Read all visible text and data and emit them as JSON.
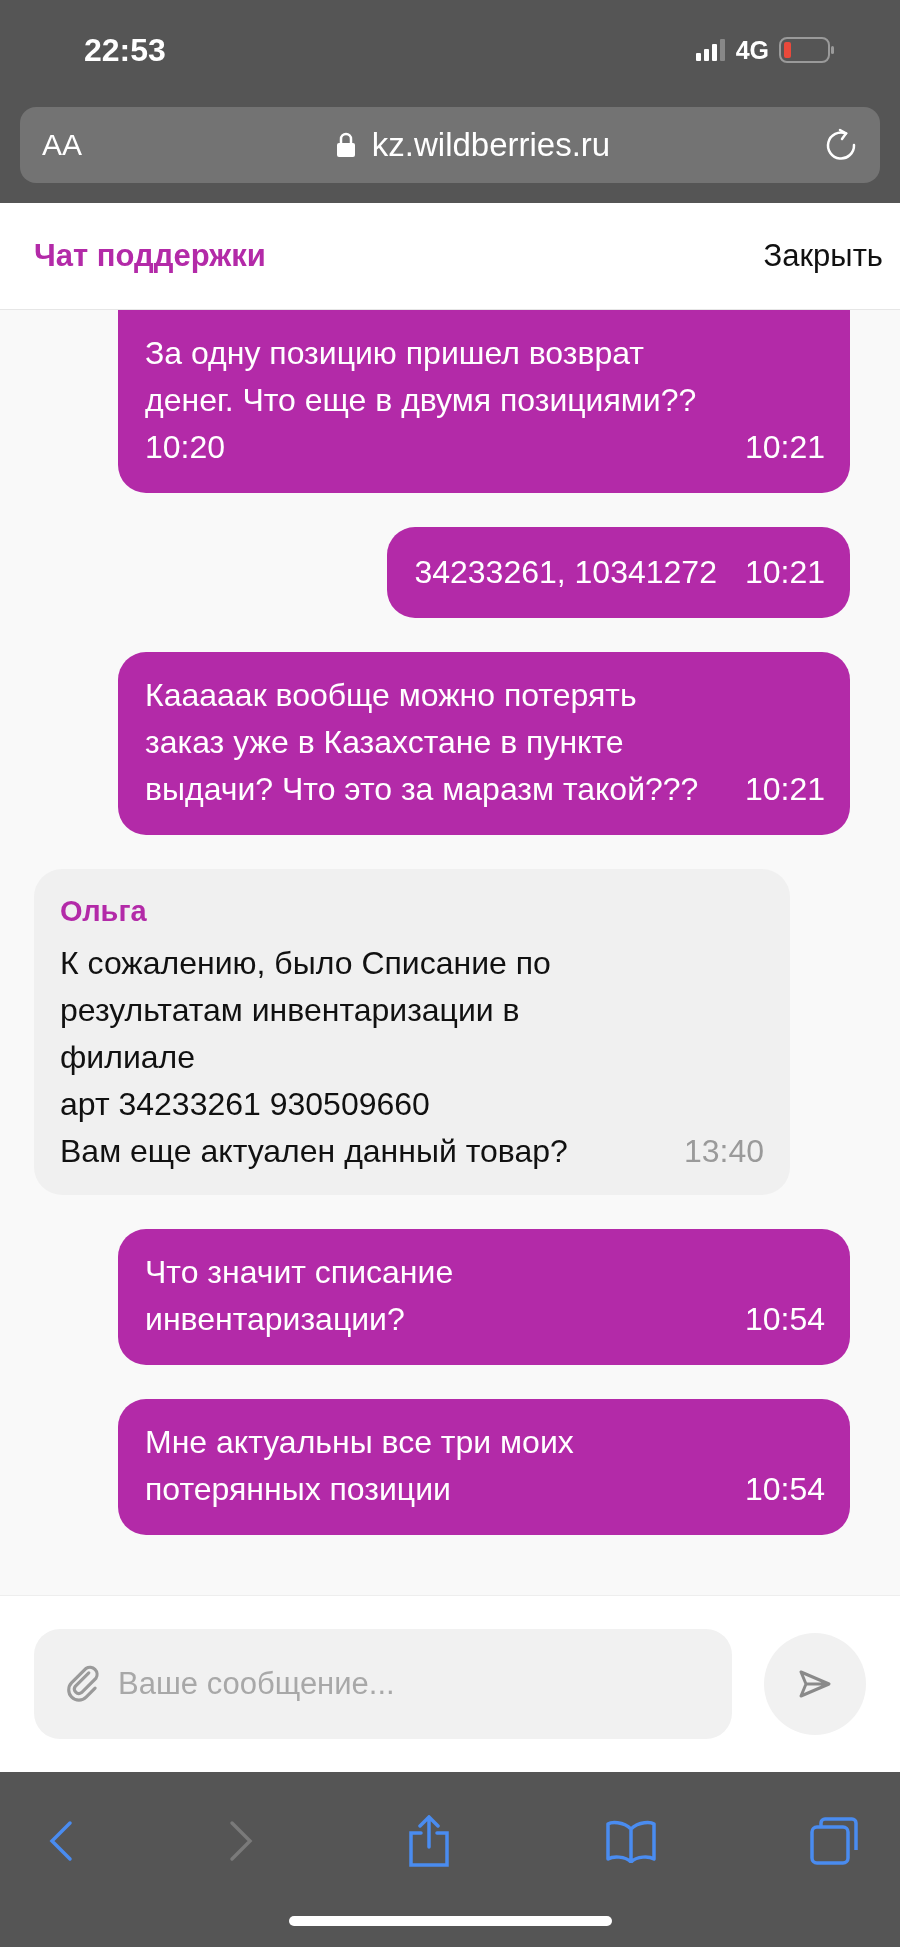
{
  "status_bar": {
    "time": "22:53",
    "network": "4G"
  },
  "browser": {
    "text_size": "AA",
    "url": "kz.wildberries.ru"
  },
  "header": {
    "title": "Чат поддержки",
    "close": "Закрыть"
  },
  "messages": [
    {
      "kind": "outgoing",
      "text": "За одну позицию пришел возврат\nденег. Что еще в двумя позициями??\n10:20",
      "time": "10:21"
    },
    {
      "kind": "outgoing",
      "text": "34233261, 10341272",
      "time": "10:21"
    },
    {
      "kind": "outgoing",
      "text": "Кааааак вообще можно потерять\nзаказ уже в Казахстане в пункте\nвыдачи? Что это за маразм такой???",
      "time": "10:21"
    },
    {
      "kind": "incoming",
      "author": "Ольга",
      "text": "К сожалению, было Списание по\nрезультатам инвентаризации в\nфилиале\nарт 34233261 930509660\nВам еще актуален данный товар?",
      "time": "13:40"
    },
    {
      "kind": "outgoing",
      "text": "Что значит списание\nинвентаризации?",
      "time": "10:54"
    },
    {
      "kind": "outgoing",
      "text": "Мне актуальны все три моих\nпотерянных позиции",
      "time": "10:54"
    }
  ],
  "composer": {
    "placeholder": "Ваше сообщение..."
  }
}
